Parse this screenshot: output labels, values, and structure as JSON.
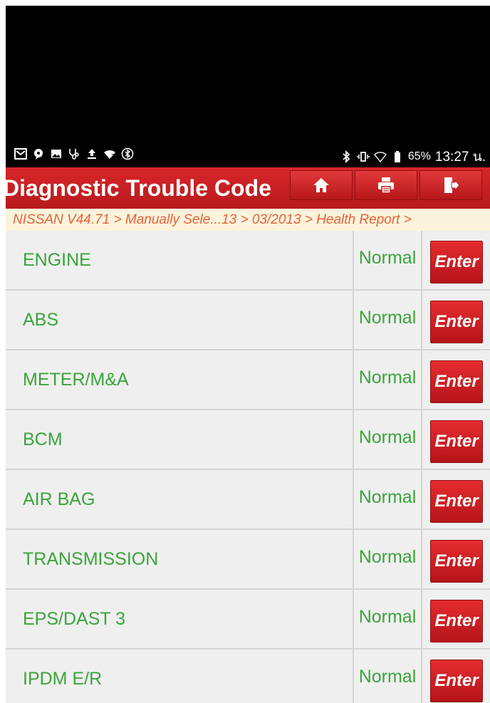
{
  "status_bar": {
    "left_icons": [
      "mail-icon",
      "message-icon",
      "image-icon",
      "stethoscope-icon",
      "upload-icon",
      "wifi-question-icon",
      "bluetooth-circle-icon"
    ],
    "right_icons": [
      "bluetooth-icon",
      "vibrate-icon",
      "wifi-icon",
      "battery-icon"
    ],
    "battery": "65%",
    "time": "13:27 น."
  },
  "header": {
    "title": "Diagnostic Trouble Code",
    "buttons": [
      "home-icon",
      "print-icon",
      "exit-icon"
    ]
  },
  "breadcrumb": "NISSAN V44.71 > Manually Sele...13 > 03/2013 > Health Report >",
  "rows": [
    {
      "name": "ENGINE",
      "status": "Normal",
      "action": "Enter"
    },
    {
      "name": "ABS",
      "status": "Normal",
      "action": "Enter"
    },
    {
      "name": "METER/M&A",
      "status": "Normal",
      "action": "Enter"
    },
    {
      "name": "BCM",
      "status": "Normal",
      "action": "Enter"
    },
    {
      "name": "AIR BAG",
      "status": "Normal",
      "action": "Enter"
    },
    {
      "name": "TRANSMISSION",
      "status": "Normal",
      "action": "Enter"
    },
    {
      "name": "EPS/DAST 3",
      "status": "Normal",
      "action": "Enter"
    },
    {
      "name": "IPDM E/R",
      "status": "Normal",
      "action": "Enter"
    }
  ],
  "colors": {
    "header_red": "#c61f1f",
    "text_green": "#3aa43a",
    "breadcrumb_orange": "#e8613a",
    "breadcrumb_bg": "#fbf3dc"
  }
}
